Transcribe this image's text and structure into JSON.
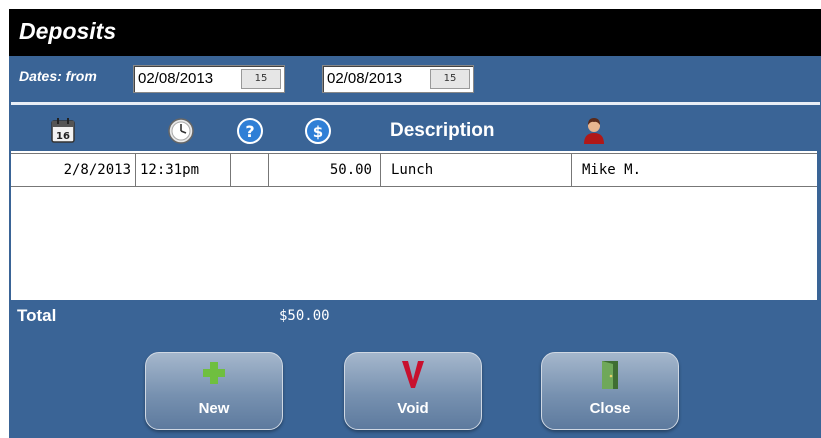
{
  "window": {
    "title": "Deposits"
  },
  "filter": {
    "dates_label": "Dates: from",
    "from_date": "02/08/2013",
    "to_date": "02/08/2013",
    "calendar_icon_text": "15"
  },
  "table": {
    "headers": [
      {
        "icon": "calendar-icon",
        "text": "16"
      },
      {
        "icon": "clock-icon"
      },
      {
        "icon": "question-icon",
        "text": "?"
      },
      {
        "icon": "dollar-icon",
        "text": "$"
      },
      {
        "label": "Description"
      },
      {
        "icon": "person-icon"
      }
    ],
    "rows": [
      {
        "date": "2/8/2013",
        "time": "12:31pm",
        "flag": "",
        "amount": "50.00",
        "description": "Lunch",
        "user": "Mike M."
      }
    ]
  },
  "total": {
    "label": "Total",
    "value": "$50.00"
  },
  "buttons": {
    "new_label": "New",
    "void_label": "Void",
    "close_label": "Close"
  },
  "colors": {
    "window_bg": "#3a6496",
    "titlebar_bg": "#000000",
    "new_icon": "#6fbf3f",
    "void_icon": "#c8102e",
    "close_icon": "#5e8f4a"
  }
}
